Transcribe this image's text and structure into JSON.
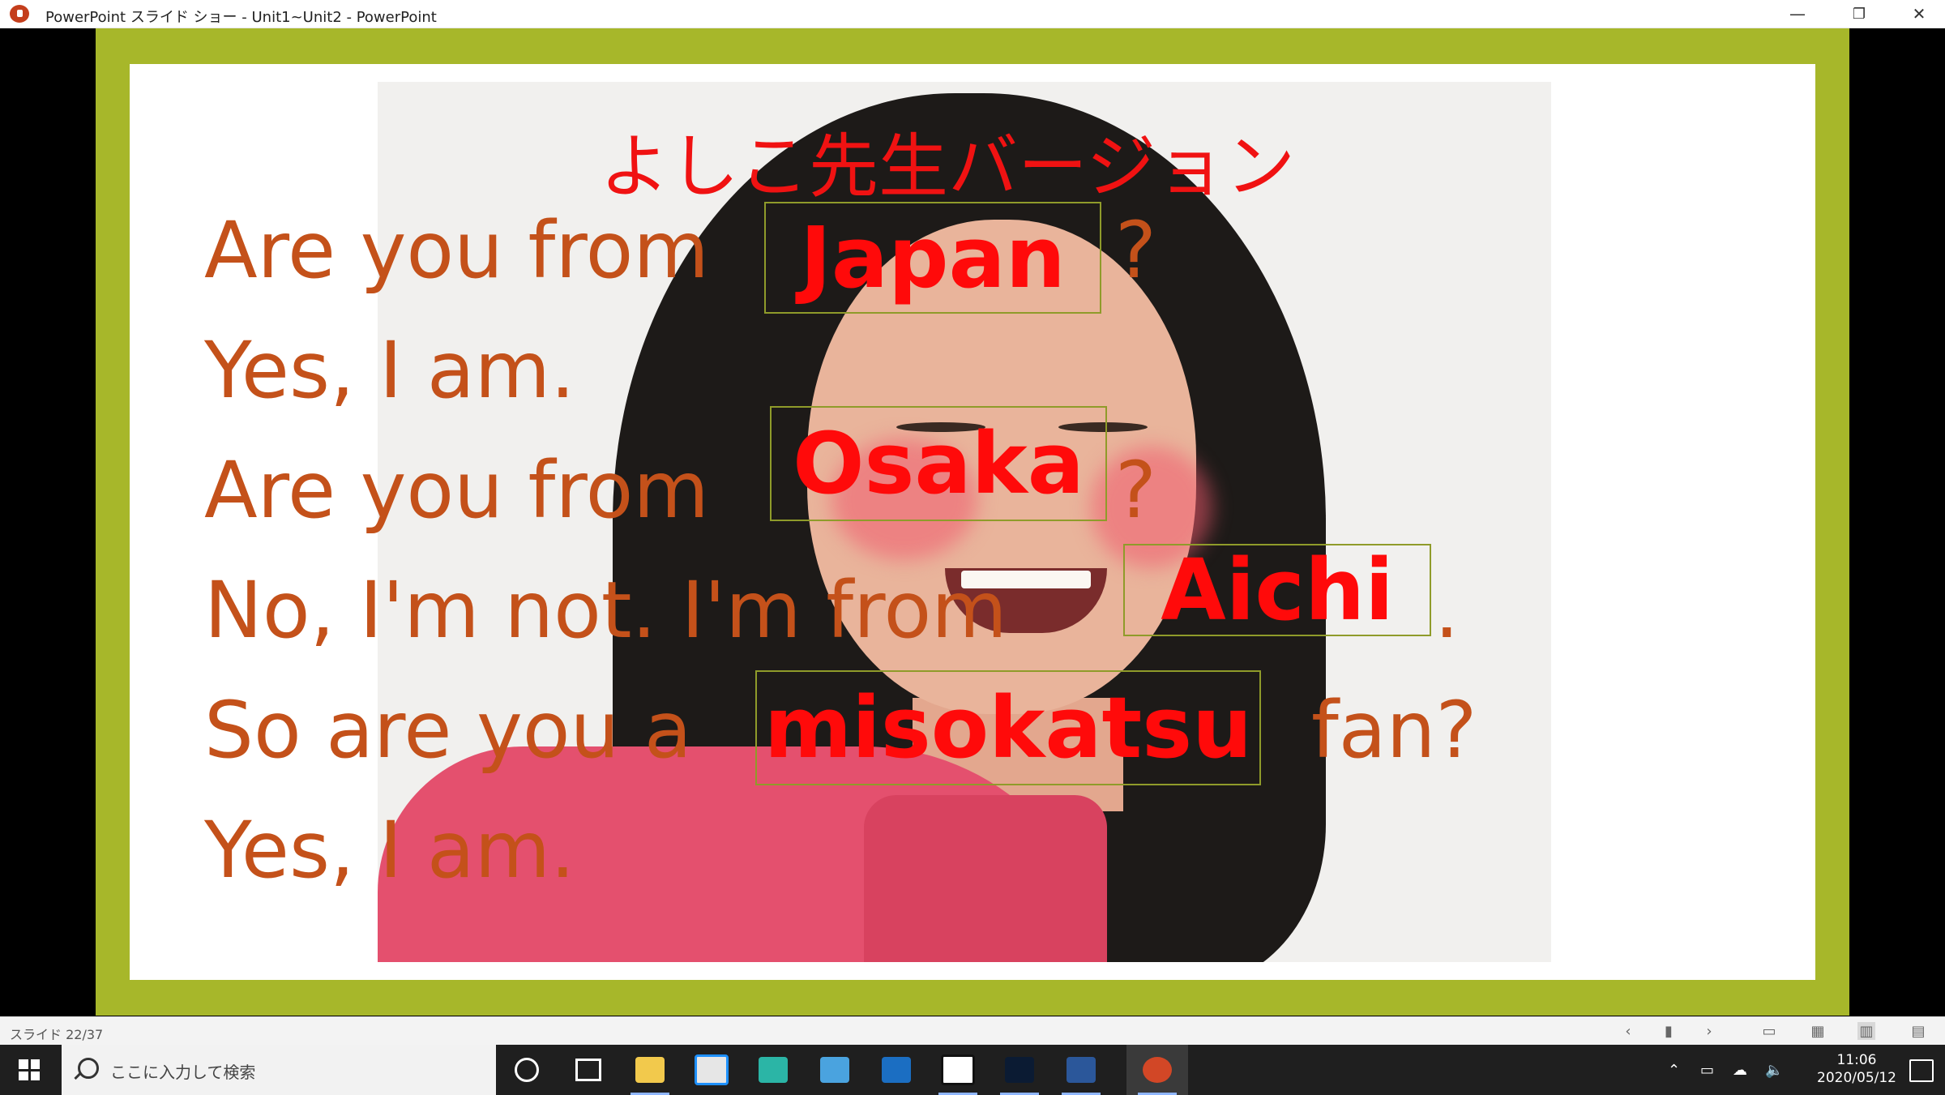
{
  "window": {
    "title": "PowerPoint スライド ショー  -  Unit1~Unit2 - PowerPoint",
    "minimize": "—",
    "restore": "❐",
    "close": "✕"
  },
  "slide": {
    "heading": "よしこ先生バージョン",
    "lines": [
      {
        "text": "Are you from",
        "box": "Japan",
        "after": "?"
      },
      {
        "text": "Yes, I am."
      },
      {
        "text": "Are you from",
        "box": "Osaka",
        "after": "?"
      },
      {
        "text": "No, I'm not.  I'm from",
        "box": "Aichi",
        "after": "."
      },
      {
        "text": "So are you a",
        "box": "misokatsu",
        "after": "fan?"
      },
      {
        "text": "Yes, I am."
      }
    ],
    "colors": {
      "frame": "#a7b72a",
      "text": "#c4511a",
      "highlight": "#ff0a0a"
    }
  },
  "statusbar": {
    "slide_indicator": "スライド 22/37",
    "icons": [
      "prev-icon",
      "slide-thumb-icon",
      "next-icon",
      "normal-view-icon",
      "sorter-view-icon",
      "reading-view-icon",
      "slideshow-icon"
    ]
  },
  "taskbar": {
    "search_placeholder": "ここに入力して検索",
    "time": "11:06",
    "date": "2020/05/12",
    "apps": [
      "cortana-icon",
      "task-view-icon",
      "file-explorer-icon",
      "store-icon",
      "app-teal-icon",
      "photos-icon",
      "mail-icon",
      "app-black-icon",
      "app-terminal-icon",
      "word-icon",
      "powerpoint-icon"
    ]
  }
}
